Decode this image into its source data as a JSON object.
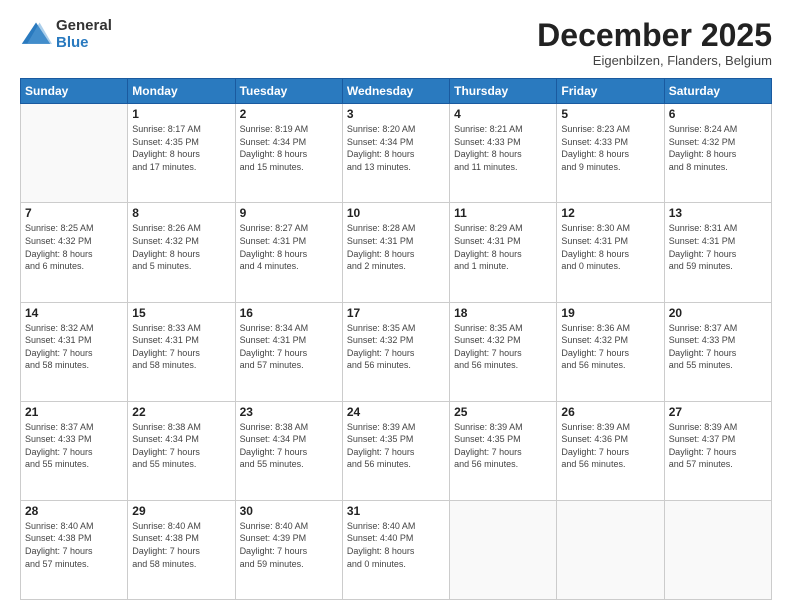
{
  "logo": {
    "general": "General",
    "blue": "Blue"
  },
  "header": {
    "month": "December 2025",
    "location": "Eigenbilzen, Flanders, Belgium"
  },
  "weekdays": [
    "Sunday",
    "Monday",
    "Tuesday",
    "Wednesday",
    "Thursday",
    "Friday",
    "Saturday"
  ],
  "weeks": [
    [
      {
        "day": "",
        "info": ""
      },
      {
        "day": "1",
        "info": "Sunrise: 8:17 AM\nSunset: 4:35 PM\nDaylight: 8 hours\nand 17 minutes."
      },
      {
        "day": "2",
        "info": "Sunrise: 8:19 AM\nSunset: 4:34 PM\nDaylight: 8 hours\nand 15 minutes."
      },
      {
        "day": "3",
        "info": "Sunrise: 8:20 AM\nSunset: 4:34 PM\nDaylight: 8 hours\nand 13 minutes."
      },
      {
        "day": "4",
        "info": "Sunrise: 8:21 AM\nSunset: 4:33 PM\nDaylight: 8 hours\nand 11 minutes."
      },
      {
        "day": "5",
        "info": "Sunrise: 8:23 AM\nSunset: 4:33 PM\nDaylight: 8 hours\nand 9 minutes."
      },
      {
        "day": "6",
        "info": "Sunrise: 8:24 AM\nSunset: 4:32 PM\nDaylight: 8 hours\nand 8 minutes."
      }
    ],
    [
      {
        "day": "7",
        "info": "Sunrise: 8:25 AM\nSunset: 4:32 PM\nDaylight: 8 hours\nand 6 minutes."
      },
      {
        "day": "8",
        "info": "Sunrise: 8:26 AM\nSunset: 4:32 PM\nDaylight: 8 hours\nand 5 minutes."
      },
      {
        "day": "9",
        "info": "Sunrise: 8:27 AM\nSunset: 4:31 PM\nDaylight: 8 hours\nand 4 minutes."
      },
      {
        "day": "10",
        "info": "Sunrise: 8:28 AM\nSunset: 4:31 PM\nDaylight: 8 hours\nand 2 minutes."
      },
      {
        "day": "11",
        "info": "Sunrise: 8:29 AM\nSunset: 4:31 PM\nDaylight: 8 hours\nand 1 minute."
      },
      {
        "day": "12",
        "info": "Sunrise: 8:30 AM\nSunset: 4:31 PM\nDaylight: 8 hours\nand 0 minutes."
      },
      {
        "day": "13",
        "info": "Sunrise: 8:31 AM\nSunset: 4:31 PM\nDaylight: 7 hours\nand 59 minutes."
      }
    ],
    [
      {
        "day": "14",
        "info": "Sunrise: 8:32 AM\nSunset: 4:31 PM\nDaylight: 7 hours\nand 58 minutes."
      },
      {
        "day": "15",
        "info": "Sunrise: 8:33 AM\nSunset: 4:31 PM\nDaylight: 7 hours\nand 58 minutes."
      },
      {
        "day": "16",
        "info": "Sunrise: 8:34 AM\nSunset: 4:31 PM\nDaylight: 7 hours\nand 57 minutes."
      },
      {
        "day": "17",
        "info": "Sunrise: 8:35 AM\nSunset: 4:32 PM\nDaylight: 7 hours\nand 56 minutes."
      },
      {
        "day": "18",
        "info": "Sunrise: 8:35 AM\nSunset: 4:32 PM\nDaylight: 7 hours\nand 56 minutes."
      },
      {
        "day": "19",
        "info": "Sunrise: 8:36 AM\nSunset: 4:32 PM\nDaylight: 7 hours\nand 56 minutes."
      },
      {
        "day": "20",
        "info": "Sunrise: 8:37 AM\nSunset: 4:33 PM\nDaylight: 7 hours\nand 55 minutes."
      }
    ],
    [
      {
        "day": "21",
        "info": "Sunrise: 8:37 AM\nSunset: 4:33 PM\nDaylight: 7 hours\nand 55 minutes."
      },
      {
        "day": "22",
        "info": "Sunrise: 8:38 AM\nSunset: 4:34 PM\nDaylight: 7 hours\nand 55 minutes."
      },
      {
        "day": "23",
        "info": "Sunrise: 8:38 AM\nSunset: 4:34 PM\nDaylight: 7 hours\nand 55 minutes."
      },
      {
        "day": "24",
        "info": "Sunrise: 8:39 AM\nSunset: 4:35 PM\nDaylight: 7 hours\nand 56 minutes."
      },
      {
        "day": "25",
        "info": "Sunrise: 8:39 AM\nSunset: 4:35 PM\nDaylight: 7 hours\nand 56 minutes."
      },
      {
        "day": "26",
        "info": "Sunrise: 8:39 AM\nSunset: 4:36 PM\nDaylight: 7 hours\nand 56 minutes."
      },
      {
        "day": "27",
        "info": "Sunrise: 8:39 AM\nSunset: 4:37 PM\nDaylight: 7 hours\nand 57 minutes."
      }
    ],
    [
      {
        "day": "28",
        "info": "Sunrise: 8:40 AM\nSunset: 4:38 PM\nDaylight: 7 hours\nand 57 minutes."
      },
      {
        "day": "29",
        "info": "Sunrise: 8:40 AM\nSunset: 4:38 PM\nDaylight: 7 hours\nand 58 minutes."
      },
      {
        "day": "30",
        "info": "Sunrise: 8:40 AM\nSunset: 4:39 PM\nDaylight: 7 hours\nand 59 minutes."
      },
      {
        "day": "31",
        "info": "Sunrise: 8:40 AM\nSunset: 4:40 PM\nDaylight: 8 hours\nand 0 minutes."
      },
      {
        "day": "",
        "info": ""
      },
      {
        "day": "",
        "info": ""
      },
      {
        "day": "",
        "info": ""
      }
    ]
  ]
}
